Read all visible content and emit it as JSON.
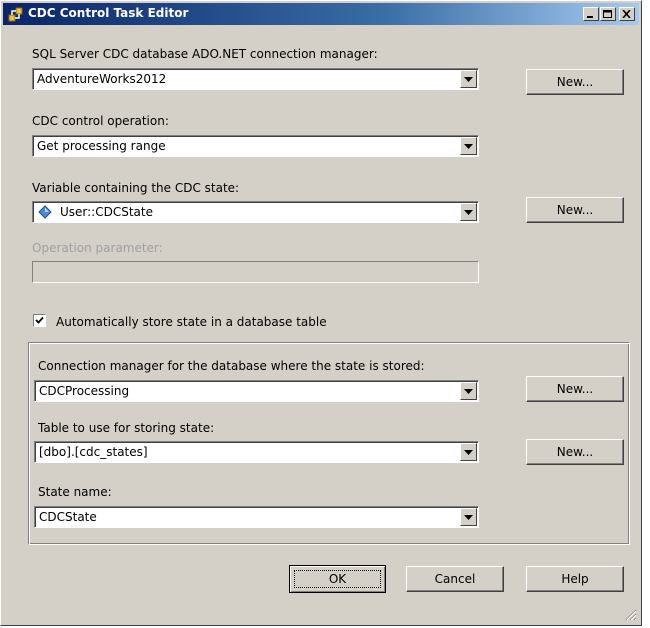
{
  "window": {
    "title": "CDC Control Task Editor",
    "colors": {
      "title_start": "#0a246a",
      "title_end": "#a6caf0",
      "face": "#d4d0c8"
    }
  },
  "connection": {
    "label": "SQL Server CDC database ADO.NET connection manager:",
    "value": "AdventureWorks2012",
    "new_label": "New..."
  },
  "operation": {
    "label": "CDC control operation:",
    "value": "Get processing range"
  },
  "state_variable": {
    "label": "Variable containing the CDC state:",
    "value": "User::CDCState",
    "icon": "variable-icon",
    "new_label": "New..."
  },
  "operation_parameter": {
    "label": "Operation parameter:",
    "value": ""
  },
  "auto_store": {
    "label": "Automatically store state in a database table",
    "checked": true
  },
  "state_storage": {
    "connection_label": "Connection manager for the database where the state is stored:",
    "connection_value": "CDCProcessing",
    "connection_new_label": "New...",
    "table_label": "Table to use for storing state:",
    "table_value": "[dbo].[cdc_states]",
    "table_new_label": "New...",
    "state_name_label": "State name:",
    "state_name_value": "CDCState"
  },
  "footer": {
    "ok_label": "OK",
    "cancel_label": "Cancel",
    "help_label": "Help"
  }
}
